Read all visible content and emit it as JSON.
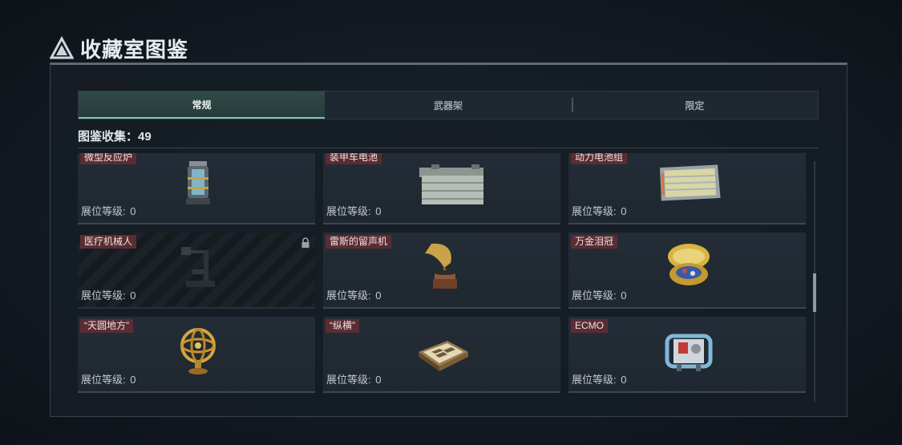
{
  "header": {
    "title": "收藏室图鉴",
    "logo_icon": "triangle-logo-icon"
  },
  "tabs": [
    {
      "label": "常规",
      "active": true
    },
    {
      "label": "武器架",
      "active": false
    },
    {
      "label": "限定",
      "active": false
    }
  ],
  "collection": {
    "label": "图鉴收集：",
    "count": "49"
  },
  "cards": [
    {
      "name": "微型反应炉",
      "level_label": "展位等级:",
      "level": "0",
      "locked": false,
      "icon": "reactor-icon"
    },
    {
      "name": "装甲车电池",
      "level_label": "展位等级:",
      "level": "0",
      "locked": false,
      "icon": "battery-icon"
    },
    {
      "name": "动力电池组",
      "level_label": "展位等级:",
      "level": "0",
      "locked": false,
      "icon": "battery-pack-icon"
    },
    {
      "name": "医疗机械人",
      "level_label": "展位等级:",
      "level": "0",
      "locked": true,
      "icon": "medical-robot-icon"
    },
    {
      "name": "雷斯的留声机",
      "level_label": "展位等级:",
      "level": "0",
      "locked": false,
      "icon": "gramophone-icon"
    },
    {
      "name": "万金泪冠",
      "level_label": "展位等级:",
      "level": "0",
      "locked": false,
      "icon": "jewel-egg-icon"
    },
    {
      "name": "“天圆地方”",
      "level_label": "展位等级:",
      "level": "0",
      "locked": false,
      "icon": "armillary-sphere-icon"
    },
    {
      "name": "“纵横”",
      "level_label": "展位等级:",
      "level": "0",
      "locked": false,
      "icon": "chessboard-icon"
    },
    {
      "name": "ECMO",
      "level_label": "展位等级:",
      "level": "0",
      "locked": false,
      "icon": "ecmo-machine-icon"
    }
  ],
  "colors": {
    "accent": "#7fc8b4",
    "name_tag": "#5a2d33",
    "panel": "#161d25"
  }
}
